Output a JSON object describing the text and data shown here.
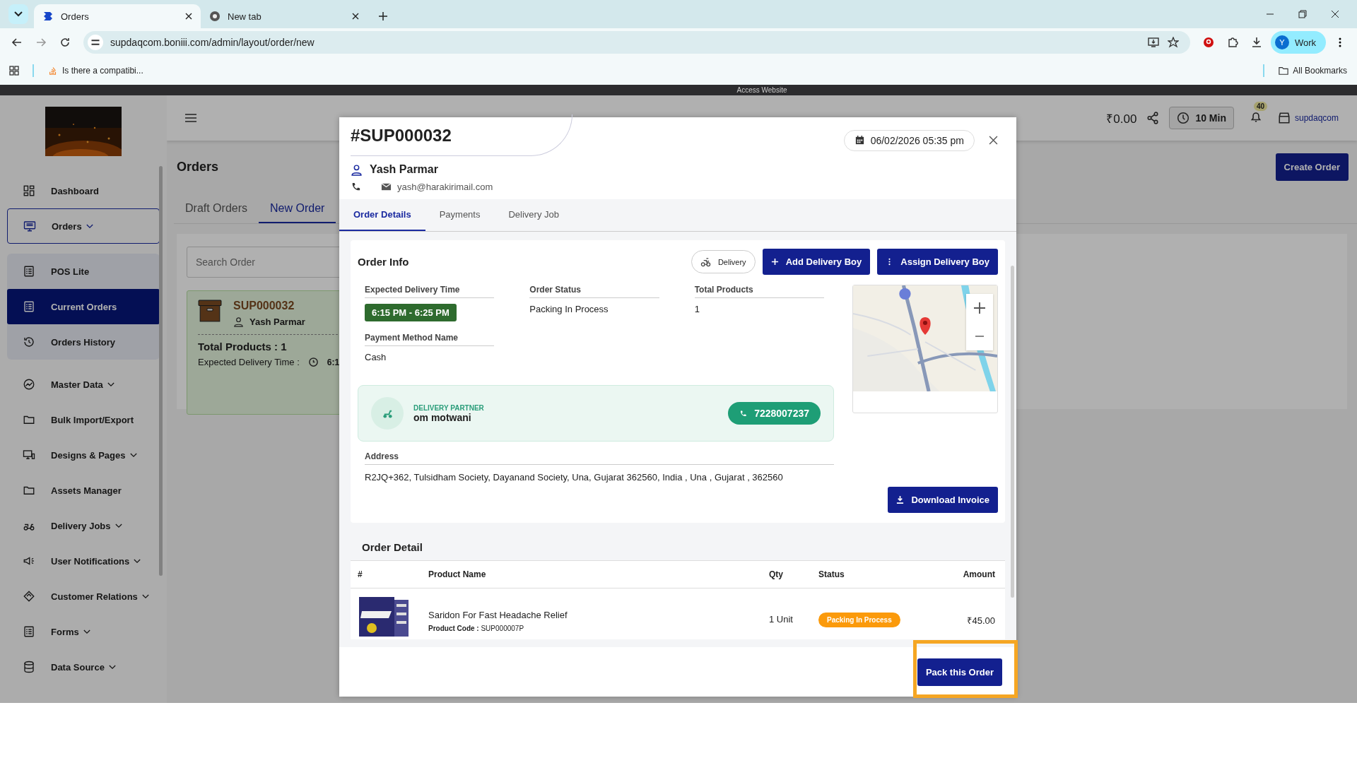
{
  "browser": {
    "tabs": [
      {
        "title": "Orders",
        "selected": true
      },
      {
        "title": "New tab",
        "selected": false
      }
    ],
    "url": "supdaqcom.boniii.com/admin/layout/order/new",
    "bookmarks": [
      "Is there a compatibi..."
    ],
    "all_bookmarks": "All Bookmarks",
    "profile": {
      "initial": "Y",
      "label": "Work"
    }
  },
  "banner": "Access Website",
  "sidebar": {
    "items": [
      {
        "label": "Dashboard",
        "expandable": false,
        "expanded": false,
        "selected": false
      },
      {
        "label": "Orders",
        "expandable": true,
        "expanded": true,
        "selected": false,
        "children": [
          {
            "label": "POS Lite",
            "selected": false
          },
          {
            "label": "Current Orders",
            "selected": true
          },
          {
            "label": "Orders History",
            "selected": false
          }
        ]
      },
      {
        "label": "Master Data",
        "expandable": true,
        "expanded": false,
        "selected": false
      },
      {
        "label": "Bulk Import/Export",
        "expandable": false,
        "expanded": false,
        "selected": false
      },
      {
        "label": "Designs & Pages",
        "expandable": true,
        "expanded": false,
        "selected": false
      },
      {
        "label": "Assets Manager",
        "expandable": false,
        "expanded": false,
        "selected": false
      },
      {
        "label": "Delivery Jobs",
        "expandable": true,
        "expanded": false,
        "selected": false
      },
      {
        "label": "User Notifications",
        "expandable": true,
        "expanded": false,
        "selected": false
      },
      {
        "label": "Customer Relations",
        "expandable": true,
        "expanded": false,
        "selected": false
      },
      {
        "label": "Forms",
        "expandable": true,
        "expanded": false,
        "selected": false
      },
      {
        "label": "Data Source",
        "expandable": true,
        "expanded": false,
        "selected": false
      }
    ]
  },
  "header": {
    "balance": "₹0.00",
    "timer": "10 Min",
    "notifications": "40",
    "store": "supdaqcom"
  },
  "page": {
    "title": "Orders",
    "create_button": "Create Order",
    "tabs": [
      {
        "label": "Draft Orders",
        "selected": false
      },
      {
        "label": "New Order",
        "selected": true
      }
    ],
    "search": {
      "placeholder": "Search Order"
    },
    "order_card": {
      "id": "SUP000032",
      "customer": "Yash Parmar",
      "total": "Total Products : 1",
      "expected_label": "Expected Delivery Time :",
      "expected_time": "6:1"
    }
  },
  "modal": {
    "order_no": "#SUP000032",
    "date": "06/02/2026 05:35 pm",
    "customer": "Yash Parmar",
    "email": "yash@harakirimail.com",
    "tabs": [
      {
        "label": "Order Details",
        "selected": true
      },
      {
        "label": "Payments",
        "selected": false
      },
      {
        "label": "Delivery Job",
        "selected": false
      }
    ],
    "order_info": {
      "title": "Order Info",
      "mode": "Delivery",
      "buttons": [
        {
          "label": "Add Delivery Boy",
          "kind": "add"
        },
        {
          "label": "Assign Delivery Boy",
          "kind": "more"
        }
      ],
      "fields": [
        {
          "label": "Expected Delivery Time",
          "value": "6:15 PM - 6:25 PM",
          "kind": "badge"
        },
        {
          "label": "Order Status",
          "value": "Packing In Process",
          "kind": "text"
        },
        {
          "label": "Total Products",
          "value": "1",
          "kind": "text"
        },
        {
          "label": "Payment Method Name",
          "value": "Cash",
          "kind": "text"
        }
      ],
      "delivery_partner": {
        "label": "DELIVERY PARTNER",
        "name": "om motwani",
        "phone": "7228007237"
      },
      "address": {
        "label": "Address",
        "value": "R2JQ+362, Tulsidham Society, Dayanand Society, Una, Gujarat 362560, India , Una , Gujarat , 362560"
      },
      "download_button": "Download Invoice"
    },
    "order_detail": {
      "title": "Order Detail",
      "columns": [
        "#",
        "Product Name",
        "Qty",
        "Status",
        "Amount"
      ],
      "rows": [
        {
          "product": "Saridon For Fast Headache Relief",
          "code_label": "Product Code :",
          "code": "SUP000007P",
          "qty": "1 Unit",
          "status": "Packing In Process",
          "amount": "₹45.00"
        }
      ]
    },
    "footer_button": "Pack this Order",
    "footer_button_highlighted": true
  }
}
